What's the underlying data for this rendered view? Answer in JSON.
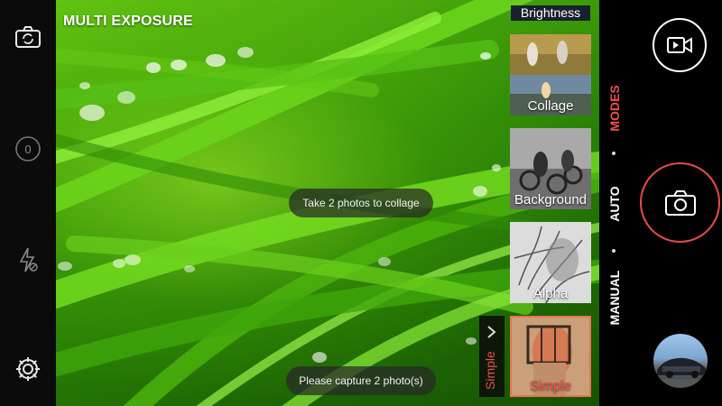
{
  "app": {
    "mode_title": "MULTI EXPOSURE"
  },
  "left_rail": {
    "icons": [
      "switch-camera-icon",
      "timer-icon",
      "flash-off-icon",
      "settings-icon"
    ],
    "timer_value": "0"
  },
  "viewfinder": {
    "hint_toast": "Take 2 photos to collage",
    "status_toast": "Please capture 2 photo(s)"
  },
  "options": {
    "top_partial_label": "Brightness",
    "thumbnails": [
      {
        "label": "Collage"
      },
      {
        "label": "Background"
      },
      {
        "label": "Alpha"
      },
      {
        "label": "Simple",
        "selected": true
      }
    ],
    "expand_tab_label": "Simple",
    "accent_color": "#ef4f4f"
  },
  "right_panel": {
    "modes": [
      {
        "label": "MODES",
        "active": true
      },
      {
        "label": "AUTO",
        "active": false
      },
      {
        "label": "MANUAL",
        "active": false
      }
    ],
    "video_button_icon": "video-camera-icon",
    "shutter_icon": "camera-icon",
    "shutter_ring_color": "#e74c4c"
  }
}
